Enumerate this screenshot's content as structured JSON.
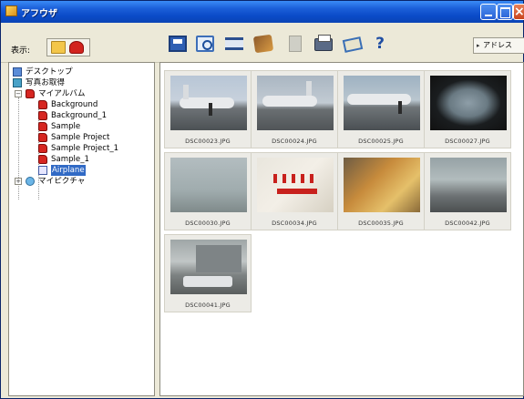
{
  "window": {
    "title": "アフウザ",
    "controls": [
      "minimize",
      "maximize",
      "close"
    ]
  },
  "toolbar": {
    "view_label": "表示:",
    "address_label": "アドレス",
    "tools": [
      "save-icon",
      "scan-icon",
      "frame-icon",
      "edit-icon",
      "trash-icon",
      "print-icon",
      "mail-icon",
      "help-icon"
    ],
    "help_glyph": "?"
  },
  "tree": {
    "items": [
      {
        "label": "デスクトップ",
        "icon": "desktop-icon"
      },
      {
        "label": "写真お取得",
        "icon": "photos-icon"
      },
      {
        "label": "マイアルバム",
        "icon": "album-icon",
        "expander": "−"
      },
      {
        "label": "Background",
        "icon": "album-icon"
      },
      {
        "label": "Background_1",
        "icon": "album-icon"
      },
      {
        "label": "Sample",
        "icon": "album-icon"
      },
      {
        "label": "Sample Project",
        "icon": "album-icon"
      },
      {
        "label": "Sample Project_1",
        "icon": "album-icon"
      },
      {
        "label": "Sample_1",
        "icon": "album-icon"
      },
      {
        "label": "Airplane",
        "icon": "album-icon",
        "selected": true
      },
      {
        "label": "マイピクチャ",
        "icon": "pictures-icon",
        "expander": "+"
      }
    ]
  },
  "thumbnails": [
    {
      "caption": "DSC00023.JPG",
      "kind": "airplane-photo"
    },
    {
      "caption": "DSC00024.JPG",
      "kind": "airplane-photo"
    },
    {
      "caption": "DSC00025.JPG",
      "kind": "airplane-photo"
    },
    {
      "caption": "DSC00027.JPG",
      "kind": "window-photo"
    },
    {
      "caption": "DSC00030.JPG",
      "kind": "fog-photo"
    },
    {
      "caption": "DSC00034.JPG",
      "kind": "tray-photo"
    },
    {
      "caption": "DSC00035.JPG",
      "kind": "food-photo"
    },
    {
      "caption": "DSC00042.JPG",
      "kind": "wing-photo"
    },
    {
      "caption": "DSC00041.JPG",
      "kind": "car-photo"
    }
  ]
}
